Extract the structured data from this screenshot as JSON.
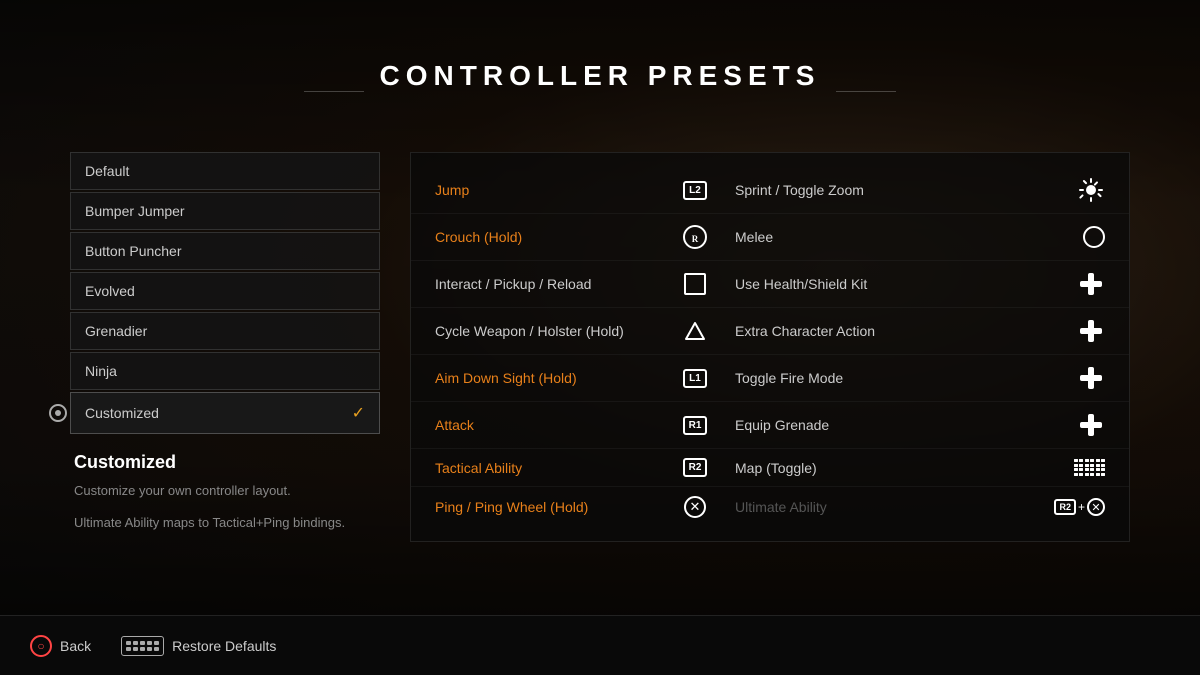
{
  "page": {
    "title": "CONTROLLER PRESETS"
  },
  "presets": {
    "items": [
      {
        "id": "default",
        "label": "Default",
        "selected": false
      },
      {
        "id": "bumper-jumper",
        "label": "Bumper Jumper",
        "selected": false
      },
      {
        "id": "button-puncher",
        "label": "Button Puncher",
        "selected": false
      },
      {
        "id": "evolved",
        "label": "Evolved",
        "selected": false
      },
      {
        "id": "grenadier",
        "label": "Grenadier",
        "selected": false
      },
      {
        "id": "ninja",
        "label": "Ninja",
        "selected": false
      },
      {
        "id": "customized",
        "label": "Customized",
        "selected": true
      }
    ],
    "selected_info": {
      "title": "Customized",
      "description": "Customize your own controller layout.",
      "note": "Ultimate Ability maps to Tactical+Ping bindings."
    }
  },
  "bindings": {
    "rows": [
      {
        "action_left": "Jump",
        "action_left_highlighted": true,
        "icon_left": "L2",
        "action_right": "Sprint / Toggle Zoom",
        "action_right_dimmed": false,
        "icon_right": "starburst"
      },
      {
        "action_left": "Crouch (Hold)",
        "action_left_highlighted": true,
        "icon_left": "R3",
        "action_right": "Melee",
        "action_right_dimmed": false,
        "icon_right": "circle"
      },
      {
        "action_left": "Interact / Pickup / Reload",
        "action_left_highlighted": false,
        "icon_left": "square",
        "action_right": "Use Health/Shield Kit",
        "action_right_dimmed": false,
        "icon_right": "dpad"
      },
      {
        "action_left": "Cycle Weapon / Holster (Hold)",
        "action_left_highlighted": false,
        "icon_left": "triangle",
        "action_right": "Extra Character Action",
        "action_right_dimmed": false,
        "icon_right": "dpad"
      },
      {
        "action_left": "Aim Down Sight (Hold)",
        "action_left_highlighted": true,
        "icon_left": "L1",
        "action_right": "Toggle Fire Mode",
        "action_right_dimmed": false,
        "icon_right": "dpad"
      },
      {
        "action_left": "Attack",
        "action_left_highlighted": true,
        "icon_left": "R1",
        "action_right": "Equip Grenade",
        "action_right_dimmed": false,
        "icon_right": "dpad"
      },
      {
        "action_left": "Tactical Ability",
        "action_left_highlighted": true,
        "icon_left": "R2",
        "action_right": "Map (Toggle)",
        "action_right_dimmed": false,
        "icon_right": "grid"
      },
      {
        "action_left": "Ping / Ping Wheel (Hold)",
        "action_left_highlighted": true,
        "icon_left": "x",
        "action_right": "Ultimate Ability",
        "action_right_dimmed": true,
        "icon_right": "r2x"
      }
    ]
  },
  "bottom_bar": {
    "back_label": "Back",
    "restore_label": "Restore Defaults"
  },
  "icons": {
    "checkmark": "✓"
  }
}
